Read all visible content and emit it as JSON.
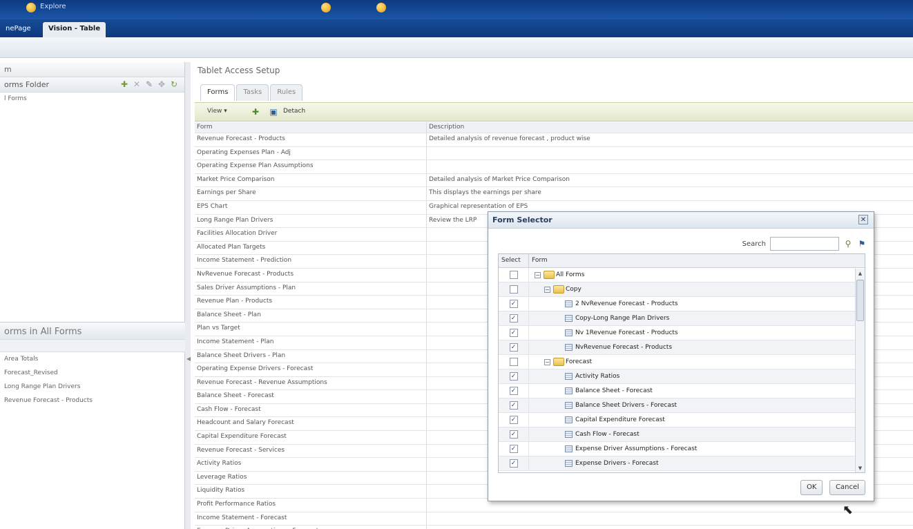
{
  "topbar": {
    "explore": "Explore"
  },
  "tabs": [
    {
      "label": "nePage"
    },
    {
      "label": "Vision - Table"
    }
  ],
  "left": {
    "header": "m",
    "folder_header": "orms Folder",
    "tree_item": "l Forms",
    "forms_header": "orms in All Forms",
    "forms_sub": "",
    "forms": [
      "Area Totals",
      "Forecast_Revised",
      "Long Range Plan Drivers",
      "Revenue Forecast - Products"
    ]
  },
  "main": {
    "title": "Tablet Access Setup",
    "tabs": [
      "Forms",
      "Tasks",
      "Rules"
    ],
    "toolbar": {
      "view": "View ▾",
      "detach": "Detach"
    },
    "columns": [
      "Form",
      "Description"
    ],
    "rows": [
      [
        "Revenue Forecast - Products",
        "Detailed analysis of revenue forecast , product wise"
      ],
      [
        "Operating Expenses Plan - Adj",
        ""
      ],
      [
        "Operating Expense Plan Assumptions",
        ""
      ],
      [
        "Market Price Comparison",
        "Detailed analysis of Market Price Comparison"
      ],
      [
        "Earnings per Share",
        "This displays the earnings per share"
      ],
      [
        "EPS Chart",
        "Graphical representation of EPS"
      ],
      [
        "Long Range Plan Drivers",
        "Review the LRP"
      ],
      [
        "Facilities Allocation Driver",
        ""
      ],
      [
        "Allocated Plan Targets",
        ""
      ],
      [
        "Income Statement - Prediction",
        ""
      ],
      [
        "NvRevenue Forecast - Products",
        ""
      ],
      [
        "Sales Driver Assumptions - Plan",
        ""
      ],
      [
        "Revenue Plan - Products",
        ""
      ],
      [
        "Balance Sheet - Plan",
        ""
      ],
      [
        "Plan vs Target",
        ""
      ],
      [
        "Income Statement - Plan",
        ""
      ],
      [
        "Balance Sheet Drivers - Plan",
        ""
      ],
      [
        "Operating Expense Drivers - Forecast",
        ""
      ],
      [
        "Revenue Forecast - Revenue Assumptions",
        ""
      ],
      [
        "Balance Sheet - Forecast",
        ""
      ],
      [
        "Cash Flow - Forecast",
        ""
      ],
      [
        "Headcount and Salary Forecast",
        ""
      ],
      [
        "Capital Expenditure Forecast",
        ""
      ],
      [
        "Revenue Forecast - Services",
        ""
      ],
      [
        "Activity Ratios",
        ""
      ],
      [
        "Leverage Ratios",
        ""
      ],
      [
        "Liquidity Ratios",
        ""
      ],
      [
        "Profit Performance Ratios",
        ""
      ],
      [
        "Income Statement - Forecast",
        ""
      ],
      [
        "Expense Driver Assumptions - Forecast",
        ""
      ]
    ]
  },
  "dialog": {
    "title": "Form Selector",
    "search_label": "Search",
    "columns": [
      "Select",
      "Form"
    ],
    "rows": [
      {
        "label": "All Forms",
        "type": "folder",
        "level": 0,
        "checked": false
      },
      {
        "label": "Copy",
        "type": "folder",
        "level": 1,
        "checked": false
      },
      {
        "label": "2 NvRevenue Forecast - Products",
        "type": "form",
        "level": 2,
        "checked": true
      },
      {
        "label": "Copy-Long Range Plan Drivers",
        "type": "form",
        "level": 2,
        "checked": true
      },
      {
        "label": "Nv 1Revenue Forecast - Products",
        "type": "form",
        "level": 2,
        "checked": true
      },
      {
        "label": "NvRevenue Forecast - Products",
        "type": "form",
        "level": 2,
        "checked": true
      },
      {
        "label": "Forecast",
        "type": "folder",
        "level": 1,
        "checked": false
      },
      {
        "label": "Activity Ratios",
        "type": "form",
        "level": 2,
        "checked": true
      },
      {
        "label": "Balance Sheet - Forecast",
        "type": "form",
        "level": 2,
        "checked": true
      },
      {
        "label": "Balance Sheet Drivers - Forecast",
        "type": "form",
        "level": 2,
        "checked": true
      },
      {
        "label": "Capital Expenditure Forecast",
        "type": "form",
        "level": 2,
        "checked": true
      },
      {
        "label": "Cash Flow - Forecast",
        "type": "form",
        "level": 2,
        "checked": true
      },
      {
        "label": "Expense Driver Assumptions - Forecast",
        "type": "form",
        "level": 2,
        "checked": true
      },
      {
        "label": "Expense Drivers - Forecast",
        "type": "form",
        "level": 2,
        "checked": true
      }
    ],
    "ok": "OK",
    "cancel": "Cancel"
  }
}
